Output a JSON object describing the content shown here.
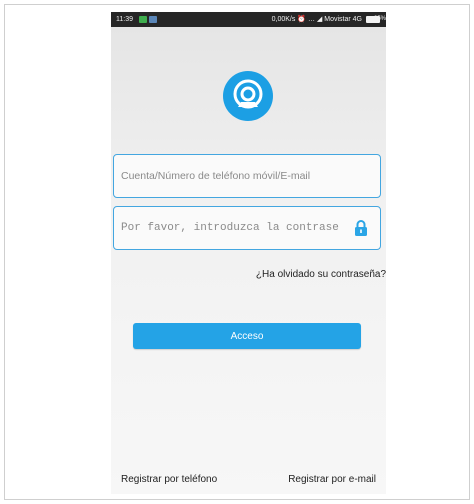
{
  "status_bar": {
    "time": "11:39",
    "right_text": "0,00K/s  ⏰  … ◢ Movistar 4G",
    "battery": "95%"
  },
  "app": {
    "logo_icon": "camera-icon",
    "brand_color": "#1c9fe4"
  },
  "login": {
    "account_placeholder": "Cuenta/Número de teléfono móvil/E-mail",
    "password_placeholder": "Por favor, introduzca la contrase",
    "forgot_label": "¿Ha olvidado su contraseña?",
    "submit_label": "Acceso"
  },
  "footer": {
    "register_phone": "Registrar por teléfono",
    "register_email": "Registrar por e-mail"
  }
}
